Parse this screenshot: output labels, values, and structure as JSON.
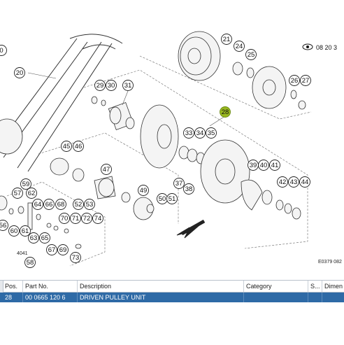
{
  "diagram": {
    "ref_code": "E0379 082",
    "view_label": "08 20 3",
    "callouts": [
      "0",
      "20",
      "21",
      "24",
      "25",
      "26",
      "27",
      "28",
      "29",
      "30",
      "31",
      "33",
      "34",
      "35",
      "37",
      "38",
      "39",
      "40",
      "41",
      "42",
      "43",
      "44",
      "45",
      "46",
      "47",
      "49",
      "50",
      "51",
      "52",
      "53",
      "56",
      "57",
      "59",
      "60",
      "61",
      "62",
      "63",
      "64",
      "65",
      "66",
      "67",
      "68",
      "69",
      "70",
      "71",
      "72",
      "73",
      "74",
      "4041",
      "58"
    ],
    "highlighted": "28"
  },
  "table": {
    "columns": [
      "Pos.",
      "Part No.",
      "Description",
      "Category",
      "S...",
      "Dimen"
    ],
    "rows": [
      {
        "pos": "28",
        "part_no": "00 0665 120 6",
        "description": "DRIVEN PULLEY UNIT",
        "category": "",
        "s": "",
        "dimension": ""
      }
    ]
  },
  "colors": {
    "selection": "#2e6aa6",
    "highlight_callout": "#9ab820"
  },
  "icons": [
    "eye-icon",
    "chevron-icon"
  ]
}
